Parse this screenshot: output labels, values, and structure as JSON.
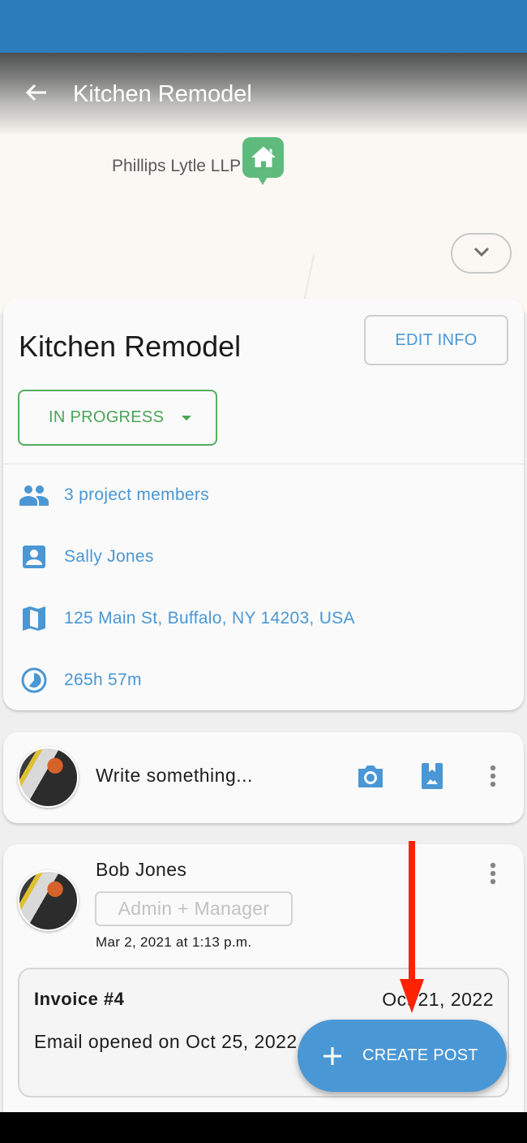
{
  "toolbar": {
    "title": "Kitchen Remodel",
    "back_icon": "arrow-left-icon"
  },
  "map": {
    "place_label": "Phillips Lytle LLP",
    "pin_icon": "home-pin-icon",
    "pin_color": "#5fba7d",
    "collapse_icon": "chevron-down-icon"
  },
  "project": {
    "title": "Kitchen Remodel",
    "edit_label": "EDIT INFO",
    "status": "IN PROGRESS",
    "status_color": "#4aa457",
    "details": [
      {
        "icon": "people-icon",
        "text": "3 project members"
      },
      {
        "icon": "contact-icon",
        "text": "Sally Jones"
      },
      {
        "icon": "map-icon",
        "text": "125 Main St, Buffalo, NY 14203, USA"
      },
      {
        "icon": "clock-icon",
        "text": "265h 57m"
      }
    ]
  },
  "composer": {
    "placeholder": "Write something...",
    "camera_icon": "camera-icon",
    "gallery_icon": "photo-album-icon",
    "more_icon": "more-vertical-icon"
  },
  "post": {
    "author": "Bob Jones",
    "role": "Admin + Manager",
    "date": "Mar 2, 2021 at 1:13 p.m.",
    "invoice": {
      "title": "Invoice #4",
      "date": "Oct 21, 2022",
      "description": "Email opened on Oct 25, 2022 at 1:43 p.m."
    }
  },
  "fab": {
    "label": "CREATE POST",
    "icon": "plus-icon"
  },
  "colors": {
    "accent": "#4a97d5",
    "status_bar": "#2d7dbd",
    "annotation": "#ff2200"
  }
}
